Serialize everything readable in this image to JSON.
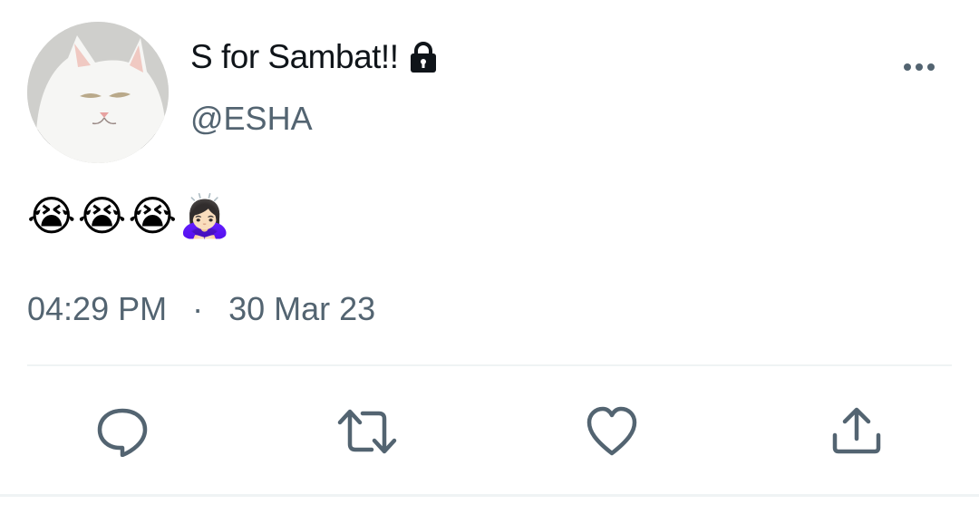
{
  "tweet": {
    "author_name": "S for Sambat!!",
    "author_handle": "@ESHA",
    "text": "😭😭😭🙇🏻‍♀️",
    "time": "04:29 PM",
    "separator": "·",
    "date": "30 Mar 23"
  },
  "icons": {
    "avatar": "white-cat-photo",
    "protected": "lock-icon",
    "more": "more-horizontal-icon",
    "reply": "reply-icon",
    "retweet": "retweet-icon",
    "like": "heart-icon",
    "share": "share-icon"
  },
  "colors": {
    "text_primary": "#0f1419",
    "text_secondary": "#536471",
    "divider": "#eff3f4"
  }
}
